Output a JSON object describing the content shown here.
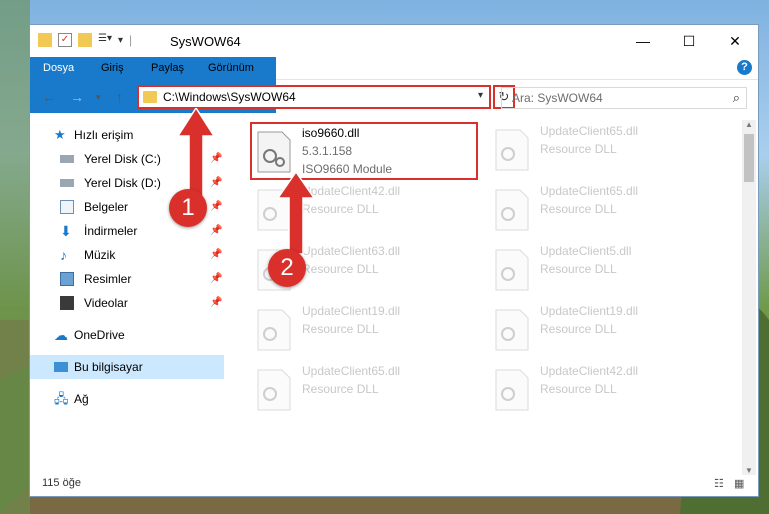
{
  "window": {
    "title": "SysWOW64"
  },
  "ribbon": {
    "tabs": [
      "Dosya",
      "Giriş",
      "Paylaş",
      "Görünüm"
    ],
    "help": "?"
  },
  "nav": {
    "address": "C:\\Windows\\SysWOW64",
    "search_placeholder": "Ara: SysWOW64"
  },
  "sidebar": {
    "items": [
      {
        "label": "Hızlı erişim",
        "icon": "star-icon"
      },
      {
        "label": "Yerel Disk (C:)",
        "icon": "drive-icon",
        "pinned": true
      },
      {
        "label": "Yerel Disk (D:)",
        "icon": "drive-icon",
        "pinned": true
      },
      {
        "label": "Belgeler",
        "icon": "documents-icon",
        "pinned": true
      },
      {
        "label": "İndirmeler",
        "icon": "download-icon",
        "pinned": true
      },
      {
        "label": "Müzik",
        "icon": "music-icon",
        "pinned": true
      },
      {
        "label": "Resimler",
        "icon": "pictures-icon",
        "pinned": true
      },
      {
        "label": "Videolar",
        "icon": "videos-icon",
        "pinned": true
      },
      {
        "label": "OneDrive",
        "icon": "onedrive-icon"
      },
      {
        "label": "Bu bilgisayar",
        "icon": "computer-icon",
        "selected": true
      },
      {
        "label": "Ağ",
        "icon": "network-icon"
      }
    ]
  },
  "files": {
    "main": {
      "name": "iso9660.dll",
      "version": "5.3.1.158",
      "description": "ISO9660 Module"
    },
    "faded_left": [
      {
        "name": "UpdateClient42.dll",
        "type": "Resource DLL"
      },
      {
        "name": "UpdateClient63.dll",
        "type": "Resource DLL"
      },
      {
        "name": "UpdateClient19.dll",
        "type": "Resource DLL"
      },
      {
        "name": "UpdateClient65.dll",
        "type": "Resource DLL"
      }
    ],
    "faded_right": [
      {
        "name": "UpdateClient65.dll",
        "type": "Resource DLL"
      },
      {
        "name": "UpdateClient65.dll",
        "type": "Resource DLL"
      },
      {
        "name": "UpdateClient5.dll",
        "type": "Resource DLL"
      },
      {
        "name": "UpdateClient19.dll",
        "type": "Resource DLL"
      },
      {
        "name": "UpdateClient42.dll",
        "type": "Resource DLL"
      }
    ]
  },
  "status": {
    "count": "115 öğe"
  },
  "callouts": [
    "1",
    "2"
  ],
  "colors": {
    "accent": "#1979ca",
    "highlight": "#d9302c",
    "selected": "#cce8ff"
  }
}
